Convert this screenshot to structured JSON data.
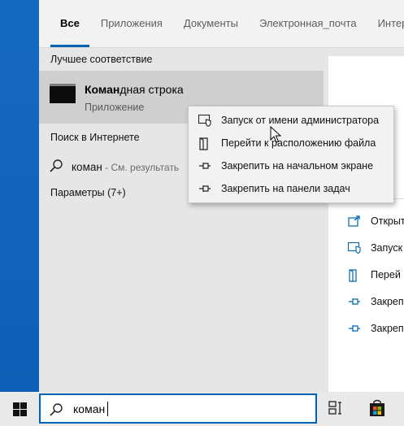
{
  "tabs": [
    {
      "label": "Все"
    },
    {
      "label": "Приложения"
    },
    {
      "label": "Документы"
    },
    {
      "label": "Электронная_почта"
    },
    {
      "label": "Интер"
    }
  ],
  "best_match": {
    "header": "Лучшее соответствие",
    "title_bold": "Коман",
    "title_rest": "дная строка",
    "subtitle": "Приложение",
    "icon": "command-prompt-icon"
  },
  "web": {
    "header": "Поиск в Интернете",
    "query": "коман",
    "hint": " - См. результать"
  },
  "settings": {
    "header": "Параметры (7+)"
  },
  "context_menu": {
    "items": [
      {
        "label": "Запуск от имени администратора",
        "icon": "shield-icon"
      },
      {
        "label": "Перейти к расположению файла",
        "icon": "file-location-icon"
      },
      {
        "label": "Закрепить на начальном экране",
        "icon": "pin-icon"
      },
      {
        "label": "Закрепить на панели задач",
        "icon": "pin-icon"
      }
    ]
  },
  "right_actions": [
    {
      "label": "Открыть",
      "icon": "open-icon"
    },
    {
      "label": "Запуск",
      "icon": "shield-icon"
    },
    {
      "label": "Перей",
      "icon": "file-location-icon"
    },
    {
      "label": "Закреп",
      "icon": "pin-icon"
    },
    {
      "label": "Закреп",
      "icon": "pin-icon"
    }
  ],
  "taskbar": {
    "search_value": "коман"
  },
  "colors": {
    "accent": "#0063b1",
    "desktop": "#1568c0",
    "panel": "#e6e6e6"
  }
}
